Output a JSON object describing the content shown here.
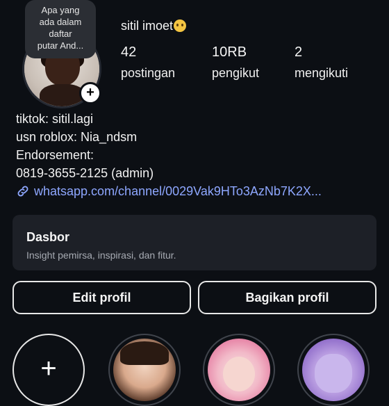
{
  "profile": {
    "note_lines": [
      "Apa yang",
      "ada dalam",
      "daftar",
      "putar And..."
    ],
    "username": "sitil imoet",
    "avatar_add_icon": "+",
    "stats": [
      {
        "value": "42",
        "label": "postingan"
      },
      {
        "value": "10RB",
        "label": "pengikut"
      },
      {
        "value": "2",
        "label": "mengikuti"
      }
    ],
    "bio": [
      "tiktok: sitil.lagi",
      "usn roblox: Nia_ndsm",
      "Endorsement:",
      "0819-3655-2125 (admin)"
    ],
    "link": "whatsapp.com/channel/0029Vak9HTo3AzNb7K2X..."
  },
  "dashboard": {
    "title": "Dasbor",
    "subtitle": "Insight pemirsa, inspirasi, dan fitur."
  },
  "buttons": {
    "edit": "Edit profil",
    "share": "Bagikan profil"
  },
  "highlights": {
    "new_icon": "+"
  },
  "colors": {
    "background": "#0c0f14",
    "link": "#8ea7ff",
    "card": "#1d2027"
  }
}
